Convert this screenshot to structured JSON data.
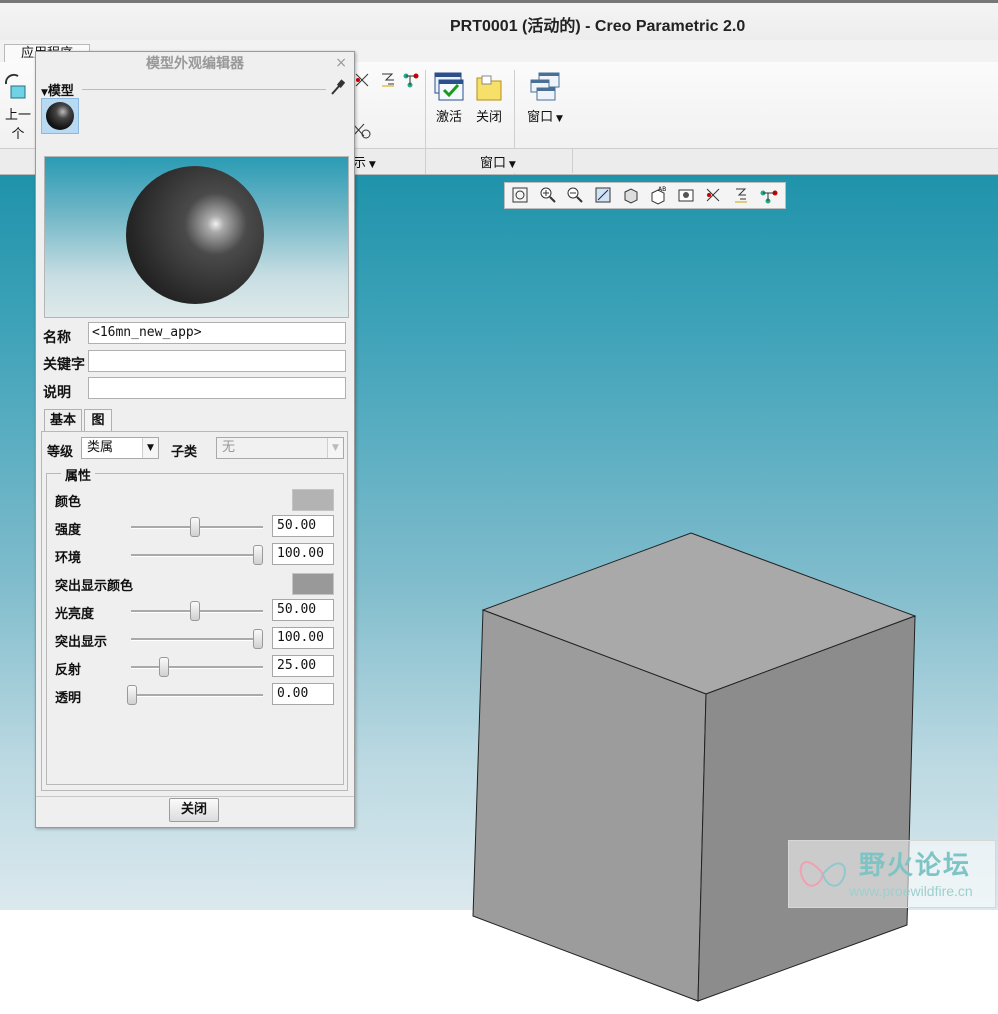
{
  "window": {
    "title": "PRT0001 (活动的) - Creo Parametric 2.0"
  },
  "ribbon": {
    "tab_visible": "应用程序",
    "left_button_partial": "上一个",
    "activate_label": "激活",
    "close_label": "关闭",
    "window_label": "窗口",
    "group_window_label": "窗口",
    "group_left_partial": "示"
  },
  "graphics_toolbar": {
    "icons": [
      "refit-icon",
      "zoom-in-icon",
      "zoom-out-icon",
      "repaint-icon",
      "display-style-icon",
      "saved-orientations-icon",
      "view-manager-icon",
      "datum-display-icon",
      "spin-center-icon",
      "annotation-display-icon"
    ]
  },
  "dialog": {
    "title": "模型外观编辑器",
    "close_icon": "×",
    "section_model": "模型",
    "name_label": "名称",
    "name_value": "<16mn_new_app>",
    "keyword_label": "关键字",
    "keyword_value": "",
    "desc_label": "说明",
    "desc_value": "",
    "tabs": [
      "基本",
      "图"
    ],
    "class_label": "等级",
    "class_value": "类属",
    "subclass_label": "子类",
    "subclass_value": "无",
    "props_legend": "属性",
    "color_label": "颜色",
    "color": "#b3b3b3",
    "props": [
      {
        "label": "强度",
        "value": "50.00",
        "fraction": 0.5
      },
      {
        "label": "环境",
        "value": "100.00",
        "fraction": 1.0
      }
    ],
    "highlight_color_label": "突出显示颜色",
    "highlight_color": "#999999",
    "props2": [
      {
        "label": "光亮度",
        "value": "50.00",
        "fraction": 0.5
      },
      {
        "label": "突出显示",
        "value": "100.00",
        "fraction": 1.0
      },
      {
        "label": "反射",
        "value": "25.00",
        "fraction": 0.25
      },
      {
        "label": "透明",
        "value": "0.00",
        "fraction": 0.0
      }
    ],
    "close_button": "关闭"
  },
  "watermark": {
    "line1": "野火论坛",
    "line2": "www.proewildfire.cn"
  }
}
